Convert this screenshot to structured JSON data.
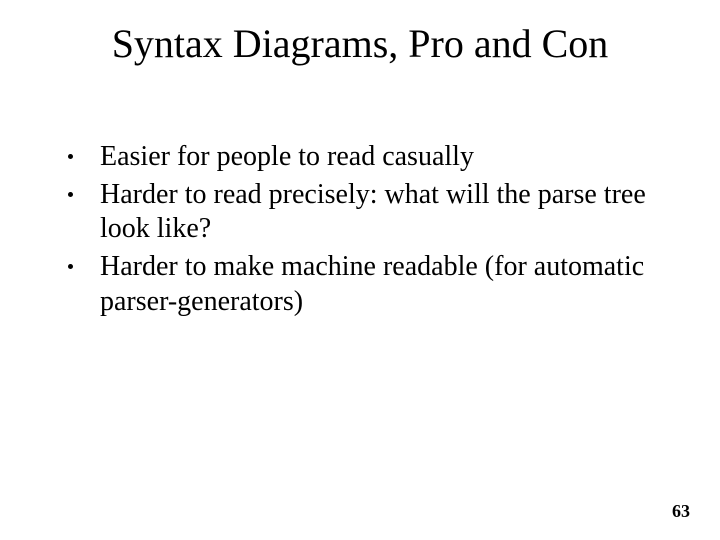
{
  "title": "Syntax Diagrams, Pro and Con",
  "bullets": [
    "Easier for people to read casually",
    "Harder to read precisely: what will the parse tree look like?",
    "Harder to make machine readable (for automatic parser-generators)"
  ],
  "page_number": "63"
}
